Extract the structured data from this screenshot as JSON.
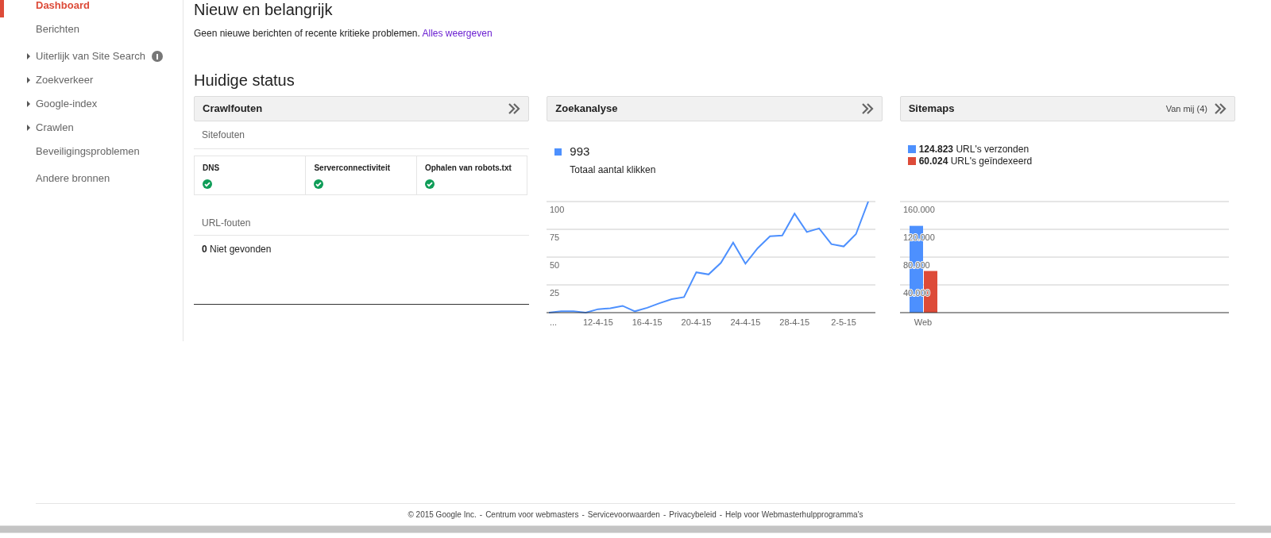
{
  "sidebar": {
    "items": [
      {
        "label": "Dashboard",
        "selected": true,
        "expandable": false,
        "info": false
      },
      {
        "label": "Berichten",
        "selected": false,
        "expandable": false,
        "info": false
      },
      {
        "label": "Uiterlijk van Site Search",
        "selected": false,
        "expandable": true,
        "info": true
      },
      {
        "label": "Zoekverkeer",
        "selected": false,
        "expandable": true,
        "info": false
      },
      {
        "label": "Google-index",
        "selected": false,
        "expandable": true,
        "info": false
      },
      {
        "label": "Crawlen",
        "selected": false,
        "expandable": true,
        "info": false
      },
      {
        "label": "Beveiligingsproblemen",
        "selected": false,
        "expandable": false,
        "info": false
      },
      {
        "label": "Andere bronnen",
        "selected": false,
        "expandable": false,
        "info": false
      }
    ]
  },
  "news": {
    "title": "Nieuw en belangrijk",
    "message": "Geen nieuwe berichten of recente kritieke problemen.",
    "link": "Alles weergeven"
  },
  "status": {
    "title": "Huidige status",
    "crawl": {
      "title": "Crawlfouten",
      "site_errors_title": "Sitefouten",
      "site_errors": [
        {
          "name": "DNS",
          "ok": true
        },
        {
          "name": "Serverconnectiviteit",
          "ok": true
        },
        {
          "name": "Ophalen van robots.txt",
          "ok": true
        }
      ],
      "url_errors_title": "URL-fouten",
      "url_errors": "**0** Niet gevonden"
    },
    "search": {
      "title": "Zoekanalyse",
      "total": "993",
      "chart_data": {
        "type": "line",
        "grid": true,
        "categories": [
          "...",
          null,
          null,
          null,
          "12-4-15",
          null,
          null,
          null,
          "16-4-15",
          null,
          null,
          null,
          "20-4-15",
          null,
          null,
          null,
          "24-4-15",
          null,
          null,
          null,
          "28-4-15",
          null,
          null,
          null,
          "2-5-15",
          null,
          null
        ],
        "series": [
          {
            "name": "Totaal aantal klikken",
            "color": "#4d90fe",
            "values": [
              0,
              1.2,
              1.2,
              0,
              3.1,
              3.9,
              6.1,
              1.2,
              4.4,
              8.5,
              12.1,
              14,
              36.3,
              34.4,
              44.8,
              63,
              44.1,
              58.1,
              68.8,
              69.5,
              89.1,
              72.6,
              75.8,
              61.7,
              59.6,
              70.7,
              100
            ]
          }
        ],
        "ylim": [
          0,
          100
        ],
        "yticks": [
          25,
          50,
          75,
          100
        ]
      }
    },
    "sitemaps": {
      "title": "Sitemaps",
      "filter": "Van mij (4)",
      "legend_counts": [
        "124.823",
        "60.024"
      ],
      "chart_data": {
        "type": "bar",
        "grid": true,
        "categories": [
          "Web"
        ],
        "series": [
          {
            "name": "URL's verzonden",
            "color": "#4d90fe",
            "values": [
              125000
            ]
          },
          {
            "name": "URL's geïndexeerd",
            "color": "#dd4b39",
            "values": [
              60000
            ]
          }
        ],
        "ylim": [
          0,
          160000
        ],
        "yticks": [
          {
            "value": 40000,
            "label": "40.000"
          },
          {
            "value": 80000,
            "label": "80.000"
          },
          {
            "value": 120000,
            "label": "120.000"
          },
          {
            "value": 160000,
            "label": "160.000"
          }
        ]
      }
    }
  },
  "footer": {
    "copyright": "© 2015 Google Inc.",
    "separator": "-",
    "links": [
      "Centrum voor webmasters",
      "Servicevoorwaarden",
      "Privacybeleid",
      "Help voor Webmasterhulpprogramma's"
    ]
  }
}
